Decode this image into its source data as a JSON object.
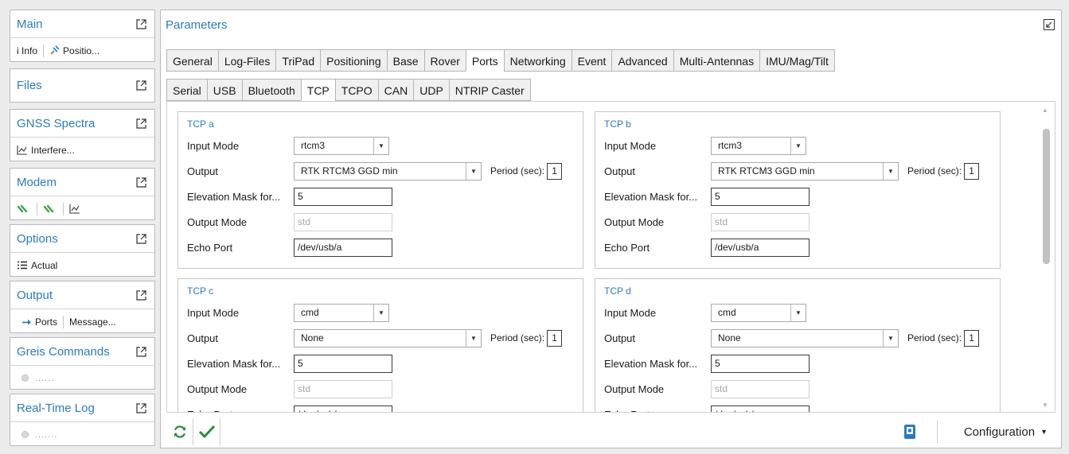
{
  "sidebar": {
    "main": {
      "title": "Main",
      "items": [
        "i Info",
        "Positio..."
      ]
    },
    "files": {
      "title": "Files"
    },
    "gnss": {
      "title": "GNSS Spectra",
      "items": [
        "Interfere..."
      ]
    },
    "modem": {
      "title": "Modem"
    },
    "options": {
      "title": "Options",
      "items": [
        "Actual"
      ]
    },
    "output": {
      "title": "Output",
      "items": [
        "Ports",
        "Message..."
      ]
    },
    "greis": {
      "title": "Greis Commands",
      "items": [
        "......"
      ]
    },
    "rtlog": {
      "title": "Real-Time Log",
      "items": [
        "......."
      ]
    }
  },
  "params": {
    "title": "Parameters",
    "tabs": [
      "General",
      "Log-Files",
      "TriPad",
      "Positioning",
      "Base",
      "Rover",
      "Ports",
      "Networking",
      "Event",
      "Advanced",
      "Multi-Antennas",
      "IMU/Mag/Tilt"
    ],
    "active_tab": "Ports",
    "subtabs": [
      "Serial",
      "USB",
      "Bluetooth",
      "TCP",
      "TCPO",
      "CAN",
      "UDP",
      "NTRIP Caster"
    ],
    "active_subtab": "TCP"
  },
  "labels": {
    "input_mode": "Input Mode",
    "output": "Output",
    "elevation": "Elevation Mask for...",
    "output_mode": "Output Mode",
    "echo_port": "Echo Port",
    "period": "Period (sec):"
  },
  "groups": {
    "a": {
      "title": "TCP a",
      "input_mode": "rtcm3",
      "output": "RTK RTCM3 GGD min",
      "period": "1",
      "elevation": "5",
      "output_mode": "std",
      "echo_port": "/dev/usb/a"
    },
    "b": {
      "title": "TCP b",
      "input_mode": "rtcm3",
      "output": "RTK RTCM3 GGD min",
      "period": "1",
      "elevation": "5",
      "output_mode": "std",
      "echo_port": "/dev/usb/a"
    },
    "c": {
      "title": "TCP c",
      "input_mode": "cmd",
      "output": "None",
      "period": "1",
      "elevation": "5",
      "output_mode": "std",
      "echo_port": "/dev/usb/a"
    },
    "d": {
      "title": "TCP d",
      "input_mode": "cmd",
      "output": "None",
      "period": "1",
      "elevation": "5",
      "output_mode": "std",
      "echo_port": "/dev/usb/a"
    }
  },
  "toolbar": {
    "config_label": "Configuration"
  },
  "icons": {
    "popout": "popout-icon",
    "info": "info-icon",
    "position": "satellite-icon",
    "chart": "chart-icon",
    "link": "link-icon",
    "list": "list-icon",
    "arrow": "arrow-right-icon",
    "refresh": "refresh-icon",
    "apply": "checkmark-icon",
    "device": "device-icon",
    "collapse": "collapse-icon"
  },
  "colors": {
    "accent": "#2c7bc0",
    "check": "#2e8b3d",
    "link": "#3aa34a"
  }
}
